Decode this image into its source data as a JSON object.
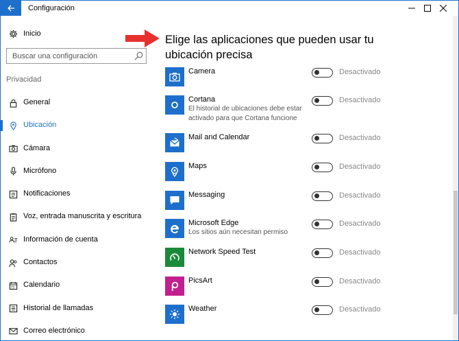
{
  "window": {
    "title": "Configuración",
    "accent_color": "#1e6fcc"
  },
  "sidebar": {
    "home": {
      "label": "Inicio",
      "icon": "gear-icon"
    },
    "search": {
      "placeholder": "Buscar una configuración"
    },
    "section_title": "Privacidad",
    "items": [
      {
        "label": "General",
        "icon": "lock-icon",
        "active": false
      },
      {
        "label": "Ubicación",
        "icon": "location-icon",
        "active": true
      },
      {
        "label": "Cámara",
        "icon": "camera-icon",
        "active": false
      },
      {
        "label": "Micrófono",
        "icon": "microphone-icon",
        "active": false
      },
      {
        "label": "Notificaciones",
        "icon": "notifications-icon",
        "active": false
      },
      {
        "label": "Voz, entrada manuscrita y escritura",
        "icon": "clipboard-icon",
        "active": false
      },
      {
        "label": "Información de cuenta",
        "icon": "account-info-icon",
        "active": false
      },
      {
        "label": "Contactos",
        "icon": "contacts-icon",
        "active": false
      },
      {
        "label": "Calendario",
        "icon": "calendar-icon",
        "active": false
      },
      {
        "label": "Historial de llamadas",
        "icon": "call-history-icon",
        "active": false
      },
      {
        "label": "Correo electrónico",
        "icon": "email-icon",
        "active": false
      }
    ]
  },
  "main": {
    "heading": "Elige las aplicaciones que pueden usar tu ubicación precisa",
    "apps": [
      {
        "name": "Camera",
        "desc": "",
        "icon": "camera-app-icon",
        "icon_bg": "#1e6fcc",
        "state": "Desactivado"
      },
      {
        "name": "Cortana",
        "desc": "El historial de ubicaciones debe estar activado para que Cortana funcione",
        "icon": "cortana-icon",
        "icon_bg": "#1e6fcc",
        "state": "Desactivado"
      },
      {
        "name": "Mail and Calendar",
        "desc": "",
        "icon": "mail-icon",
        "icon_bg": "#1e6fcc",
        "state": "Desactivado"
      },
      {
        "name": "Maps",
        "desc": "",
        "icon": "maps-icon",
        "icon_bg": "#1e6fcc",
        "state": "Desactivado"
      },
      {
        "name": "Messaging",
        "desc": "",
        "icon": "messaging-icon",
        "icon_bg": "#1e6fcc",
        "state": "Desactivado"
      },
      {
        "name": "Microsoft Edge",
        "desc": "Los sitios aún necesitan permiso",
        "icon": "edge-icon",
        "icon_bg": "#1e6fcc",
        "state": "Desactivado"
      },
      {
        "name": "Network Speed Test",
        "desc": "",
        "icon": "speedtest-icon",
        "icon_bg": "#1a8a3a",
        "state": "Desactivado"
      },
      {
        "name": "PicsArt",
        "desc": "",
        "icon": "picsart-icon",
        "icon_bg": "#c2208e",
        "state": "Desactivado"
      },
      {
        "name": "Weather",
        "desc": "",
        "icon": "weather-icon",
        "icon_bg": "#1e6fcc",
        "state": "Desactivado"
      }
    ]
  }
}
